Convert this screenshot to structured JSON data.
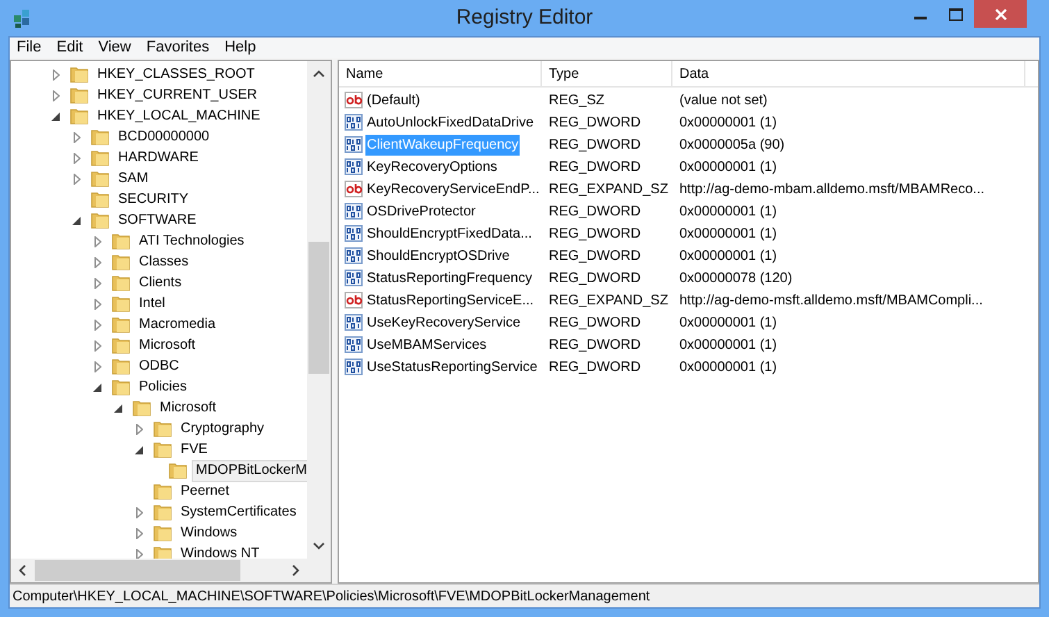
{
  "window": {
    "title": "Registry Editor"
  },
  "menu": [
    "File",
    "Edit",
    "View",
    "Favorites",
    "Help"
  ],
  "tree": [
    {
      "label": "HKEY_CLASSES_ROOT",
      "expanded": false,
      "selected": false
    },
    {
      "label": "HKEY_CURRENT_USER",
      "expanded": false,
      "selected": false
    },
    {
      "label": "HKEY_LOCAL_MACHINE",
      "expanded": true,
      "selected": false,
      "children": [
        {
          "label": "BCD00000000",
          "expanded": false,
          "selected": false
        },
        {
          "label": "HARDWARE",
          "expanded": false,
          "selected": false
        },
        {
          "label": "SAM",
          "expanded": false,
          "selected": false
        },
        {
          "label": "SECURITY",
          "selected": false
        },
        {
          "label": "SOFTWARE",
          "expanded": true,
          "selected": false,
          "children": [
            {
              "label": "ATI Technologies",
              "expanded": false,
              "selected": false
            },
            {
              "label": "Classes",
              "expanded": false,
              "selected": false
            },
            {
              "label": "Clients",
              "expanded": false,
              "selected": false
            },
            {
              "label": "Intel",
              "expanded": false,
              "selected": false
            },
            {
              "label": "Macromedia",
              "expanded": false,
              "selected": false
            },
            {
              "label": "Microsoft",
              "expanded": false,
              "selected": false
            },
            {
              "label": "ODBC",
              "expanded": false,
              "selected": false
            },
            {
              "label": "Policies",
              "expanded": true,
              "selected": false,
              "children": [
                {
                  "label": "Microsoft",
                  "expanded": true,
                  "selected": false,
                  "children": [
                    {
                      "label": "Cryptography",
                      "expanded": false,
                      "selected": false
                    },
                    {
                      "label": "FVE",
                      "expanded": true,
                      "selected": false,
                      "children": [
                        {
                          "label": "MDOPBitLockerM",
                          "selected": true
                        }
                      ]
                    },
                    {
                      "label": "Peernet",
                      "selected": false
                    },
                    {
                      "label": "SystemCertificates",
                      "expanded": false,
                      "selected": false
                    },
                    {
                      "label": "Windows",
                      "expanded": false,
                      "selected": false
                    },
                    {
                      "label": "Windows NT",
                      "expanded": false,
                      "selected": false
                    }
                  ]
                }
              ]
            }
          ]
        }
      ]
    }
  ],
  "table": {
    "columns": [
      "Name",
      "Type",
      "Data"
    ],
    "rows": [
      {
        "kind": "string",
        "name": "(Default)",
        "type": "REG_SZ",
        "data": "(value not set)",
        "selected": false
      },
      {
        "kind": "dword",
        "name": "AutoUnlockFixedDataDrive",
        "type": "REG_DWORD",
        "data": "0x00000001 (1)",
        "selected": false
      },
      {
        "kind": "dword",
        "name": "ClientWakeupFrequency",
        "type": "REG_DWORD",
        "data": "0x0000005a (90)",
        "selected": true
      },
      {
        "kind": "dword",
        "name": "KeyRecoveryOptions",
        "type": "REG_DWORD",
        "data": "0x00000001 (1)",
        "selected": false
      },
      {
        "kind": "string",
        "name": "KeyRecoveryServiceEndP...",
        "type": "REG_EXPAND_SZ",
        "data": "http://ag-demo-mbam.alldemo.msft/MBAMReco...",
        "selected": false
      },
      {
        "kind": "dword",
        "name": "OSDriveProtector",
        "type": "REG_DWORD",
        "data": "0x00000001 (1)",
        "selected": false
      },
      {
        "kind": "dword",
        "name": "ShouldEncryptFixedData...",
        "type": "REG_DWORD",
        "data": "0x00000001 (1)",
        "selected": false
      },
      {
        "kind": "dword",
        "name": "ShouldEncryptOSDrive",
        "type": "REG_DWORD",
        "data": "0x00000001 (1)",
        "selected": false
      },
      {
        "kind": "dword",
        "name": "StatusReportingFrequency",
        "type": "REG_DWORD",
        "data": "0x00000078 (120)",
        "selected": false
      },
      {
        "kind": "string",
        "name": "StatusReportingServiceE...",
        "type": "REG_EXPAND_SZ",
        "data": "http://ag-demo-msft.alldemo.msft/MBAMCompli...",
        "selected": false
      },
      {
        "kind": "dword",
        "name": "UseKeyRecoveryService",
        "type": "REG_DWORD",
        "data": "0x00000001 (1)",
        "selected": false
      },
      {
        "kind": "dword",
        "name": "UseMBAMServices",
        "type": "REG_DWORD",
        "data": "0x00000001 (1)",
        "selected": false
      },
      {
        "kind": "dword",
        "name": "UseStatusReportingService",
        "type": "REG_DWORD",
        "data": "0x00000001 (1)",
        "selected": false
      }
    ]
  },
  "status_bar": "Computer\\HKEY_LOCAL_MACHINE\\SOFTWARE\\Policies\\Microsoft\\FVE\\MDOPBitLockerManagement"
}
